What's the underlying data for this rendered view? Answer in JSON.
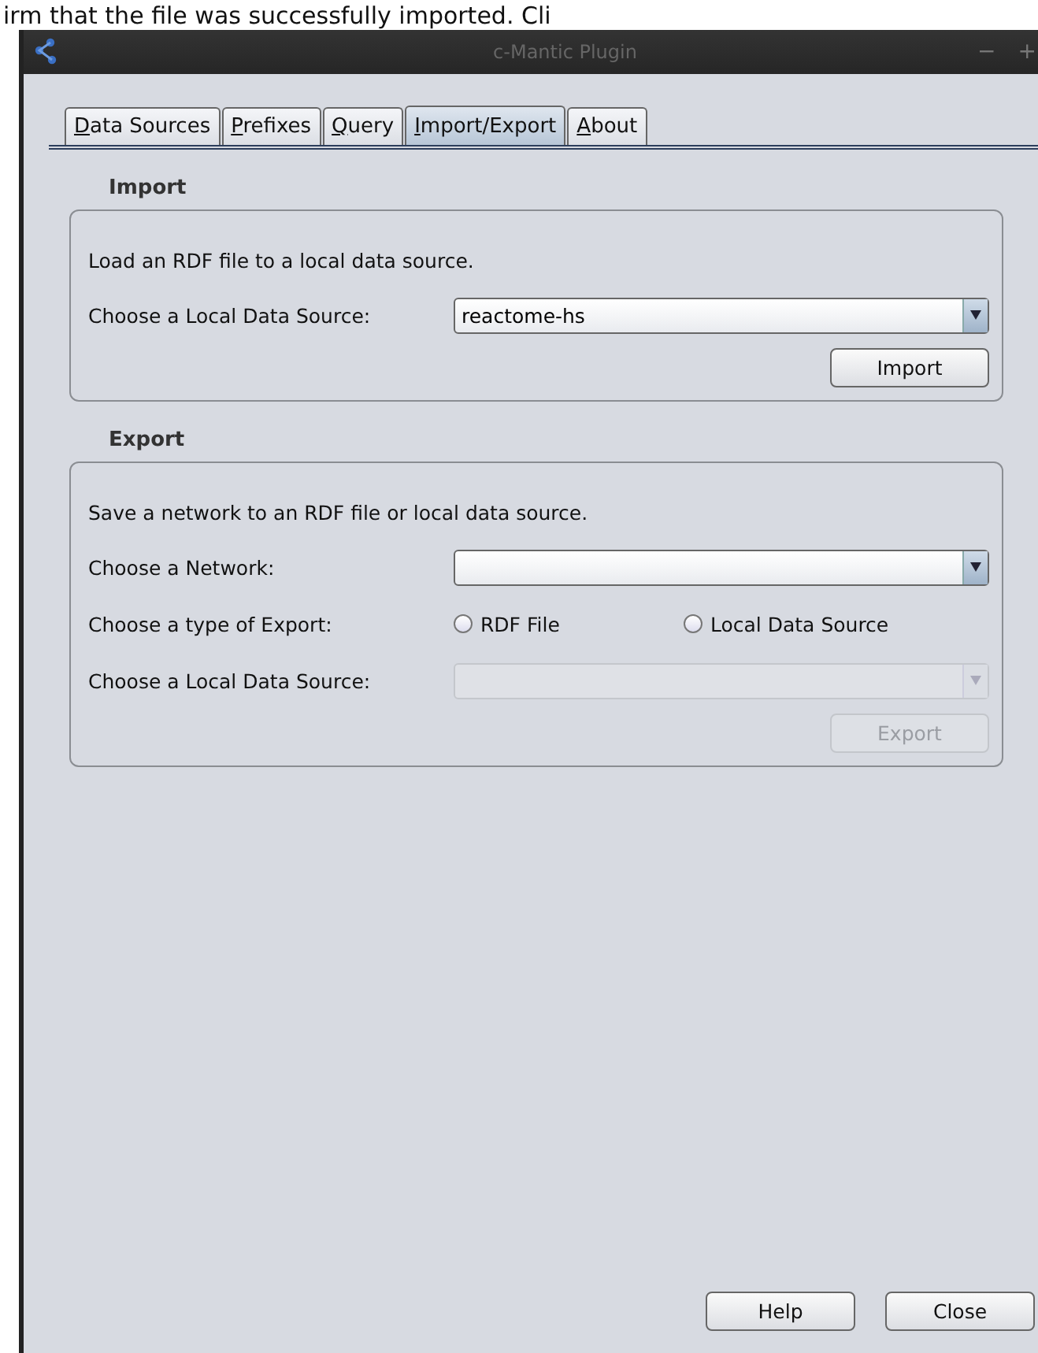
{
  "background_text": "irm that the file was successfully imported. Cli",
  "window": {
    "title": "c-Mantic Plugin",
    "controls": [
      "−",
      "+"
    ]
  },
  "tabs": [
    {
      "label": "Data Sources",
      "selected": false
    },
    {
      "label": "Prefixes",
      "selected": false
    },
    {
      "label": "Query",
      "selected": false
    },
    {
      "label": "Import/Export",
      "selected": true
    },
    {
      "label": "About",
      "selected": false
    }
  ],
  "import": {
    "heading": "Import",
    "description": "Load an RDF file to a local data source.",
    "data_source_label": "Choose a Local Data Source:",
    "data_source": {
      "value": "reactome-hs",
      "disabled": false
    },
    "button": {
      "label": "Import",
      "disabled": false
    }
  },
  "export": {
    "heading": "Export",
    "description": "Save a network to an RDF file or local data source.",
    "network_label": "Choose a Network:",
    "network": {
      "disabled": false
    },
    "type_label": "Choose a type of Export:",
    "types": [
      {
        "label": "RDF File",
        "selected": false
      },
      {
        "label": "Local Data Source",
        "selected": false
      }
    ],
    "data_source_label": "Choose a Local Data Source:",
    "data_source": {
      "disabled": true
    },
    "button": {
      "label": "Export",
      "disabled": true
    }
  },
  "buttons": [
    "Help",
    "Close"
  ]
}
